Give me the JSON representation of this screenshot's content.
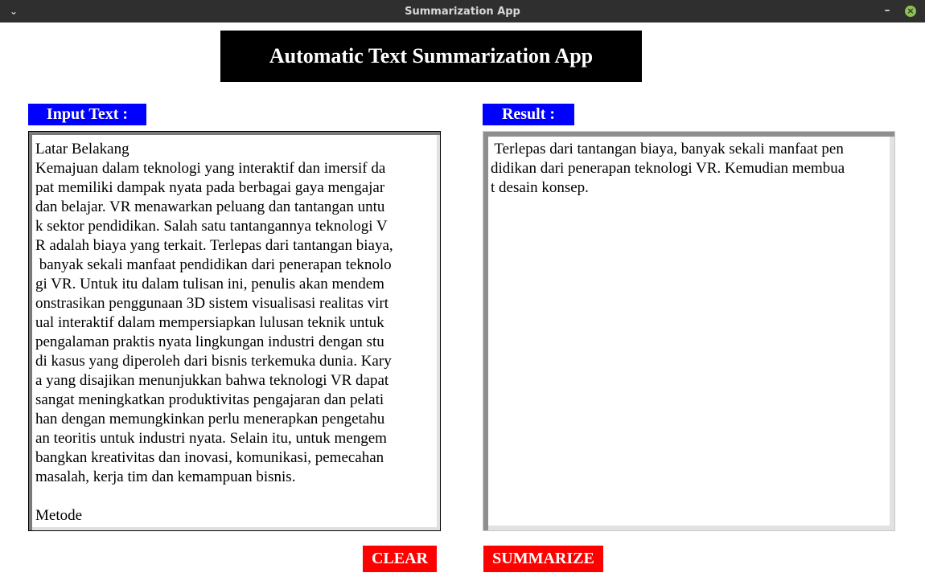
{
  "window": {
    "title": "Summarization App",
    "menu_icon": "chevron-down-icon",
    "minimize_icon": "minimize-icon",
    "close_icon": "close-icon"
  },
  "header": {
    "title": "Automatic Text Summarization App"
  },
  "input": {
    "label": "Input Text :",
    "text": "Latar Belakang\nKemajuan dalam teknologi yang interaktif dan imersif da\npat memiliki dampak nyata pada berbagai gaya mengajar\ndan belajar. VR menawarkan peluang dan tantangan untu\nk sektor pendidikan. Salah satu tantangannya teknologi V\nR adalah biaya yang terkait. Terlepas dari tantangan biaya,\n banyak sekali manfaat pendidikan dari penerapan teknolo\ngi VR. Untuk itu dalam tulisan ini, penulis akan mendem\nonstrasikan penggunaan 3D sistem visualisasi realitas virt\nual interaktif dalam mempersiapkan lulusan teknik untuk\npengalaman praktis nyata lingkungan industri dengan stu\ndi kasus yang diperoleh dari bisnis terkemuka dunia. Kary\na yang disajikan menunjukkan bahwa teknologi VR dapat\nsangat meningkatkan produktivitas pengajaran dan pelati\nhan dengan memungkinkan perlu menerapkan pengetahu\nan teoritis untuk industri nyata. Selain itu, untuk mengem\nbangkan kreativitas dan inovasi, komunikasi, pemecahan\nmasalah, kerja tim dan kemampuan bisnis.\n\nMetode"
  },
  "result": {
    "label": "Result :",
    "text": " Terlepas dari tantangan biaya, banyak sekali manfaat pen\ndidikan dari penerapan teknologi VR. Kemudian membua\nt desain konsep."
  },
  "buttons": {
    "clear_label": "CLEAR",
    "summarize_label": "SUMMARIZE"
  },
  "colors": {
    "title_bg": "#000000",
    "label_bg": "#0000ff",
    "button_bg": "#ff0000",
    "window_titlebar": "#2f2f2f"
  }
}
